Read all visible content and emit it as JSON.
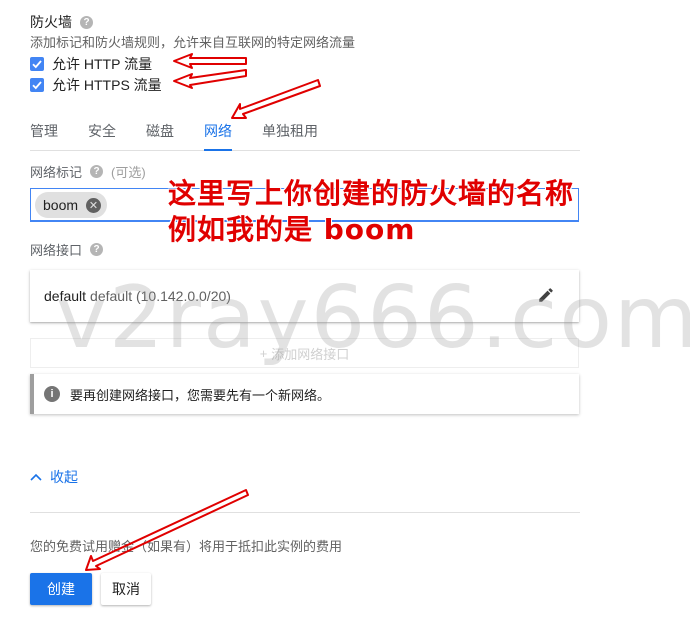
{
  "firewall": {
    "title": "防火墙",
    "description": "添加标记和防火墙规则，允许来自互联网的特定网络流量",
    "allow_http": "允许 HTTP 流量",
    "allow_https": "允许 HTTPS 流量"
  },
  "tabs": [
    {
      "label": "管理"
    },
    {
      "label": "安全"
    },
    {
      "label": "磁盘"
    },
    {
      "label": "网络"
    },
    {
      "label": "单独租用"
    }
  ],
  "network_tags": {
    "label": "网络标记",
    "optional": "(可选)",
    "chip": "boom"
  },
  "network_interfaces": {
    "label": "网络接口",
    "name": "default",
    "detail": "default (10.142.0.0/20)",
    "add_label": "添加网络接口",
    "info": "要再创建网络接口，您需要先有一个新网络。"
  },
  "collapse_label": "收起",
  "billing_note": "您的免费试用赠金（如果有）将用于抵扣此实例的费用",
  "actions": {
    "create": "创建",
    "cancel": "取消"
  },
  "annotation": {
    "line1": "这里写上你创建的防火墙的名称",
    "line2": "例如我的是 boom"
  },
  "watermark": "v2ray666.com",
  "colors": {
    "primary": "#1a73e8",
    "annotation": "#e00000"
  }
}
